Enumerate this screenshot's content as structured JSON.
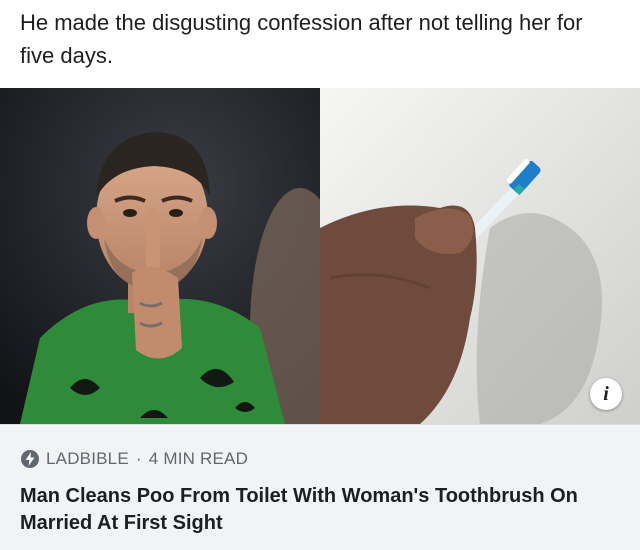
{
  "post": {
    "caption": "He made the disgusting confession after not telling her for five days."
  },
  "media": {
    "left_panel": "man-shushing-photo",
    "right_panel": "toothbrush-toilet-photo",
    "info_icon": "i"
  },
  "link": {
    "source_icon": "bolt-icon",
    "source": "LADBIBLE",
    "separator": "·",
    "read_time": "4 MIN READ",
    "headline": "Man Cleans Poo From Toilet With Woman's Toothbrush On Married At First Sight"
  },
  "colors": {
    "card_bg": "#f2f3f5",
    "meta_text": "#606770",
    "text": "#1c1e21"
  }
}
